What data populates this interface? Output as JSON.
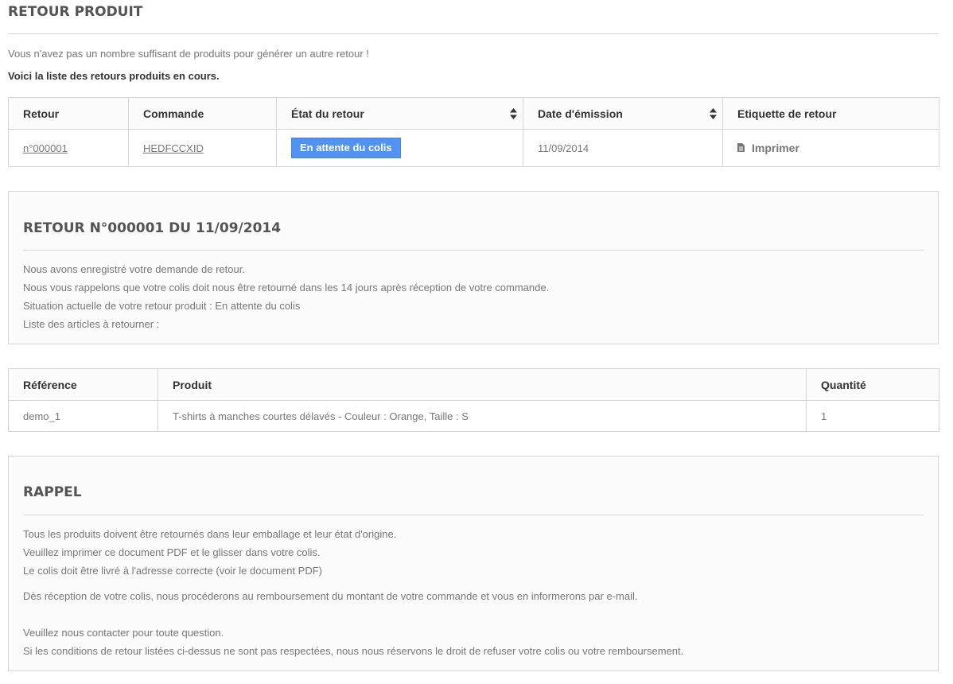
{
  "page": {
    "title": "RETOUR PRODUIT",
    "notice": "Vous n'avez pas un nombre suffisant de produits pour générer un autre retour !",
    "intro": "Voici la liste des retours produits en cours."
  },
  "returns_table": {
    "headers": {
      "retour": "Retour",
      "commande": "Commande",
      "etat": "État du retour",
      "date": "Date d'émission",
      "etiquette": "Etiquette de retour"
    },
    "rows": [
      {
        "retour": "n°000001",
        "commande": "HEDFCCXID",
        "etat": "En attente du colis",
        "date": "11/09/2014",
        "etiquette": "Imprimer"
      }
    ]
  },
  "return_detail": {
    "title": "RETOUR N°000001 DU 11/09/2014",
    "lines": [
      "Nous avons enregistré votre demande de retour.",
      "Nous vous rappelons que votre colis doit nous être retourné dans les 14 jours après réception de votre commande.",
      "Situation actuelle de votre retour produit : En attente du colis",
      "Liste des articles à retourner :"
    ]
  },
  "items_table": {
    "headers": {
      "reference": "Référence",
      "produit": "Produit",
      "quantite": "Quantité"
    },
    "rows": [
      {
        "reference": "demo_1",
        "produit": "T-shirts à manches courtes délavés - Couleur : Orange, Taille : S",
        "quantite": "1"
      }
    ]
  },
  "reminder": {
    "title": "RAPPEL",
    "lines": [
      "Tous les produits doivent être retournés dans leur emballage et leur état d'origine.",
      "Veuillez imprimer ce document PDF et le glisser dans votre colis.",
      "Le colis doit être livré à l'adresse correcte (voir le document PDF)"
    ],
    "refund_line": "Dès réception de votre colis, nous procéderons au remboursement du montant de votre commande et vous en informerons par e-mail.",
    "contact_lines": [
      "Veuillez nous contacter pour toute question.",
      "Si les conditions de retour listées ci-dessus ne sont pas respectées, nous nous réservons le droit de refuser votre colis ou votre remboursement."
    ]
  },
  "colors": {
    "status_badge": "#5192f3",
    "text": "#777777",
    "heading": "#555454",
    "border": "#d6d4d4"
  },
  "icons": {
    "sort": "sort-icon",
    "print": "document-icon"
  }
}
